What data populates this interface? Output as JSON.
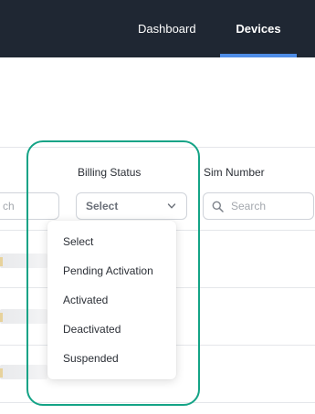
{
  "nav": {
    "tabs": [
      {
        "label": "Dashboard"
      },
      {
        "label": "Devices"
      }
    ],
    "active_tab": "Devices"
  },
  "table": {
    "columns": [
      {
        "header": "Billing Status"
      },
      {
        "header": "Sim Number"
      }
    ],
    "filters": {
      "left_search_placeholder_partial": "ch",
      "billing_select_value": "Select",
      "sim_search_placeholder": "Search"
    }
  },
  "dropdown": {
    "options": [
      "Select",
      "Pending Activation",
      "Activated",
      "Deactivated",
      "Suspended"
    ]
  },
  "colors": {
    "nav_background": "#1f2733",
    "active_tab_underline": "#4f8de6",
    "highlight": "#14a386"
  },
  "icons": {
    "select_chevron": "chevron-down-icon",
    "search": "search-icon"
  }
}
